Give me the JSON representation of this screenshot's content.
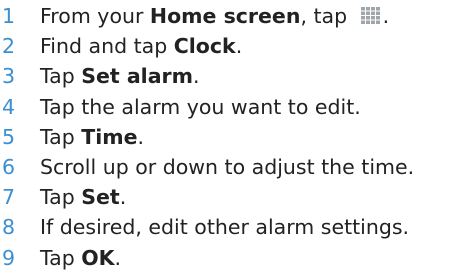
{
  "steps": [
    {
      "number": "1",
      "before": "From your ",
      "bold": "Home screen",
      "after": ", tap ",
      "icon": "application-grid-icon",
      "end": "."
    },
    {
      "number": "2",
      "before": "Find and tap ",
      "bold": "Clock",
      "after": "."
    },
    {
      "number": "3",
      "before": "Tap ",
      "bold": "Set alarm",
      "after": "."
    },
    {
      "number": "4",
      "before": "Tap the alarm you want to edit.",
      "bold": "",
      "after": ""
    },
    {
      "number": "5",
      "before": "Tap ",
      "bold": "Time",
      "after": "."
    },
    {
      "number": "6",
      "before": "Scroll up or down to adjust the time.",
      "bold": "",
      "after": ""
    },
    {
      "number": "7",
      "before": "Tap ",
      "bold": "Set",
      "after": "."
    },
    {
      "number": "8",
      "before": "If desired, edit other alarm settings.",
      "bold": "",
      "after": ""
    },
    {
      "number": "9",
      "before": "Tap ",
      "bold": "OK",
      "after": "."
    }
  ],
  "colors": {
    "step_number": "#3d8fd0",
    "text": "#222222",
    "icon_grid": "#9fa5a9"
  }
}
